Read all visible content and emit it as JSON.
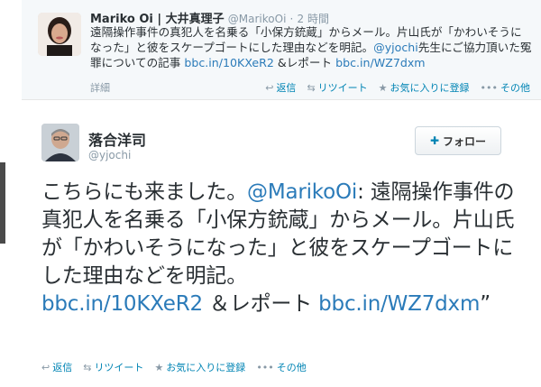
{
  "reply": {
    "name": "Mariko Oi | 大井真理子",
    "handle": "@MarikoOi",
    "separator": "·",
    "time": "2 時間",
    "text_before": "遠隔操作事件の真犯人を名乗る「小保方銃蔵」からメール。片山氏が「かわいそうになった」と彼をスケープゴートにした理由などを明記。",
    "mention": "@yjochi",
    "text_mid": "先生にご協力頂いた冤罪についての記事 ",
    "link1": "bbc.in/10KXeR2",
    "text_mid2": " &レポート ",
    "link2": "bbc.in/WZ7dxm",
    "detail_label": "詳細",
    "actions": {
      "reply": "返信",
      "retweet": "リツイート",
      "favorite": "お気に入りに登録",
      "more": "その他"
    }
  },
  "tweet": {
    "name": "落合洋司",
    "handle": "@yjochi",
    "follow_label": "フォロー",
    "text_before": "こちらにも来ました。",
    "mention": "@MarikoOi",
    "text_mid": ": 遠隔操作事件の真犯人を名乗る「小保方銃蔵」からメール。片山氏が「かわいそうになった」と彼をスケープゴートにした理由などを明記。",
    "link1": "bbc.in/10KXeR2",
    "text_mid2": " ＆レポート ",
    "link2": "bbc.in/WZ7dxm",
    "text_end": "”",
    "actions": {
      "reply": "返信",
      "retweet": "リツイート",
      "favorite": "お気に入りに登録",
      "more": "その他"
    }
  },
  "icons": {
    "reply": "reply-arrow-icon",
    "retweet": "retweet-icon",
    "favorite": "star-icon",
    "more": "dots-icon",
    "follow": "person-add-icon"
  }
}
